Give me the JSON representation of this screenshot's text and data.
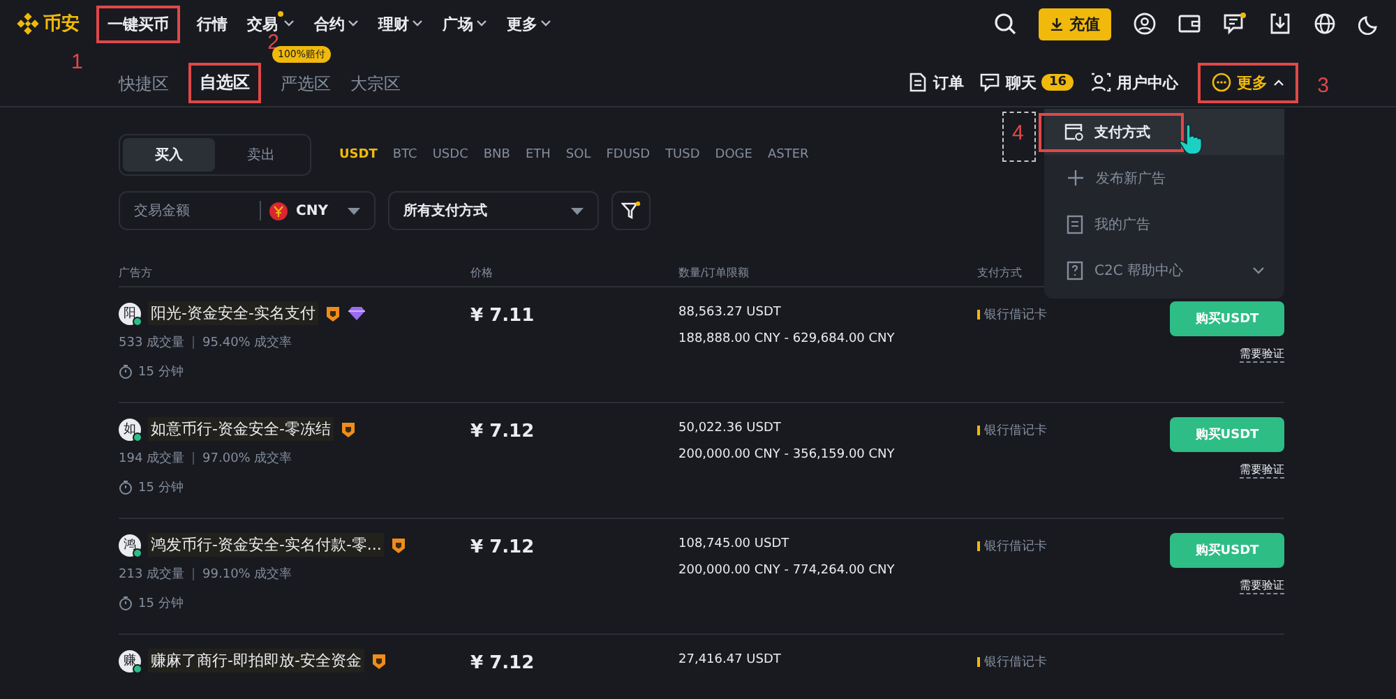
{
  "top_nav": {
    "logo": "币安",
    "items": [
      {
        "label": "一键买币",
        "has_caret": false,
        "dot": false,
        "annotation": "1"
      },
      {
        "label": "行情",
        "has_caret": false,
        "dot": false
      },
      {
        "label": "交易",
        "has_caret": true,
        "dot": true
      },
      {
        "label": "合约",
        "has_caret": true,
        "dot": false
      },
      {
        "label": "理财",
        "has_caret": true,
        "dot": false
      },
      {
        "label": "广场",
        "has_caret": true,
        "dot": false
      },
      {
        "label": "更多",
        "has_caret": true,
        "dot": false
      }
    ],
    "deposit_button": "充值"
  },
  "tabs": [
    {
      "label": "快捷区",
      "selected": false
    },
    {
      "label": "自选区",
      "selected": true,
      "annotation": "2"
    },
    {
      "label": "严选区",
      "selected": false,
      "badge": "100%赔付"
    },
    {
      "label": "大宗区",
      "selected": false
    }
  ],
  "actions": [
    {
      "kind": "orders",
      "label": "订单"
    },
    {
      "kind": "chat",
      "label": "聊天",
      "badge": "16"
    },
    {
      "kind": "user",
      "label": "用户中心"
    },
    {
      "kind": "more",
      "label": "更多",
      "expanded": true,
      "annotation": "3"
    }
  ],
  "more_menu": [
    {
      "kind": "payment",
      "label": "支付方式",
      "selected": true,
      "annotation": "4"
    },
    {
      "kind": "post",
      "label": "发布新广告",
      "selected": false
    },
    {
      "kind": "ads",
      "label": "我的广告",
      "selected": false
    },
    {
      "kind": "help",
      "label": "C2C 帮助中心",
      "selected": false,
      "has_caret": true
    }
  ],
  "side_toggle": [
    {
      "label": "买入",
      "selected": true
    },
    {
      "label": "卖出",
      "selected": false
    }
  ],
  "coins": [
    {
      "label": "USDT",
      "selected": true
    },
    {
      "label": "BTC",
      "selected": false
    },
    {
      "label": "USDC",
      "selected": false
    },
    {
      "label": "BNB",
      "selected": false
    },
    {
      "label": "ETH",
      "selected": false
    },
    {
      "label": "SOL",
      "selected": false
    },
    {
      "label": "FDUSD",
      "selected": false
    },
    {
      "label": "TUSD",
      "selected": false
    },
    {
      "label": "DOGE",
      "selected": false
    },
    {
      "label": "ASTER",
      "selected": false
    }
  ],
  "filters": {
    "amount": {
      "placeholder": "交易金额"
    },
    "currency": "CNY",
    "payment": "所有支付方式"
  },
  "table": {
    "columns": [
      "广告方",
      "价格",
      "数量/订单限额",
      "支付方式"
    ],
    "rows": [
      {
        "avatar": "阳",
        "name": "阳光-资金安全-实名支付",
        "badges": [
          {
            "kind": "shield"
          },
          {
            "kind": "diamond"
          }
        ],
        "trades": "533 成交量",
        "rate": "95.40% 成交率",
        "time": "15 分钟",
        "price": "¥ 7.11",
        "quantity": "88,563.27 USDT",
        "limit": "188,888.00 CNY - 629,684.00 CNY",
        "payment": "银行借记卡",
        "color": "#f0b90b",
        "button": "购买USDT",
        "note": "需要验证"
      },
      {
        "avatar": "如",
        "name": "如意币行-资金安全-零冻结",
        "badges": [
          {
            "kind": "shield"
          }
        ],
        "trades": "194 成交量",
        "rate": "97.00% 成交率",
        "time": "15 分钟",
        "price": "¥ 7.12",
        "quantity": "50,022.36 USDT",
        "limit": "200,000.00 CNY - 356,159.00 CNY",
        "payment": "银行借记卡",
        "color": "#f0b90b",
        "button": "购买USDT",
        "note": "需要验证"
      },
      {
        "avatar": "鸿",
        "name": "鸿发币行-资金安全-实名付款-零...",
        "badges": [
          {
            "kind": "shield"
          }
        ],
        "trades": "213 成交量",
        "rate": "99.10% 成交率",
        "time": "15 分钟",
        "price": "¥ 7.12",
        "quantity": "108,745.00 USDT",
        "limit": "200,000.00 CNY - 774,264.00 CNY",
        "payment": "银行借记卡",
        "color": "#f0b90b",
        "button": "购买USDT",
        "note": "需要验证"
      },
      {
        "avatar": "赚",
        "name": "赚麻了商行-即拍即放-安全资金",
        "badges": [
          {
            "kind": "shield"
          }
        ],
        "price": "¥ 7.12",
        "quantity": "27,416.47 USDT",
        "payment": "银行借记卡",
        "color": "#f0b90b"
      }
    ]
  }
}
